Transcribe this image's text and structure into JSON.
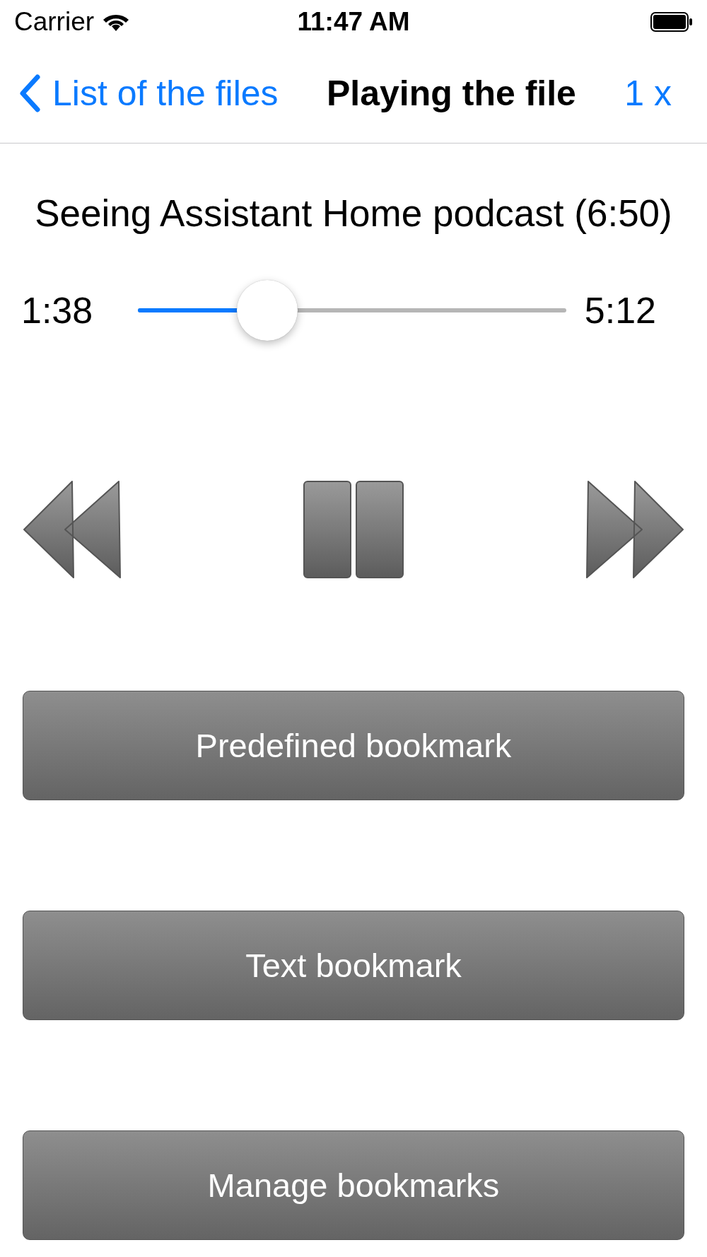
{
  "status_bar": {
    "carrier": "Carrier",
    "time": "11:47 AM"
  },
  "nav_bar": {
    "back": "List of the files",
    "title": "Playing the file",
    "speed": "1 x"
  },
  "file_title": "Seeing Assistant Home podcast (6:50)",
  "progress": {
    "elapsed": "1:38",
    "remaining": "5:12",
    "level": 0.27
  },
  "controls": [
    {
      "kind": "rewind"
    },
    {
      "kind": "pause"
    },
    {
      "kind": "forward"
    }
  ],
  "buttons": [
    {
      "label": "Predefined bookmark"
    },
    {
      "label": "Text bookmark"
    },
    {
      "label": "Manage bookmarks"
    }
  ]
}
